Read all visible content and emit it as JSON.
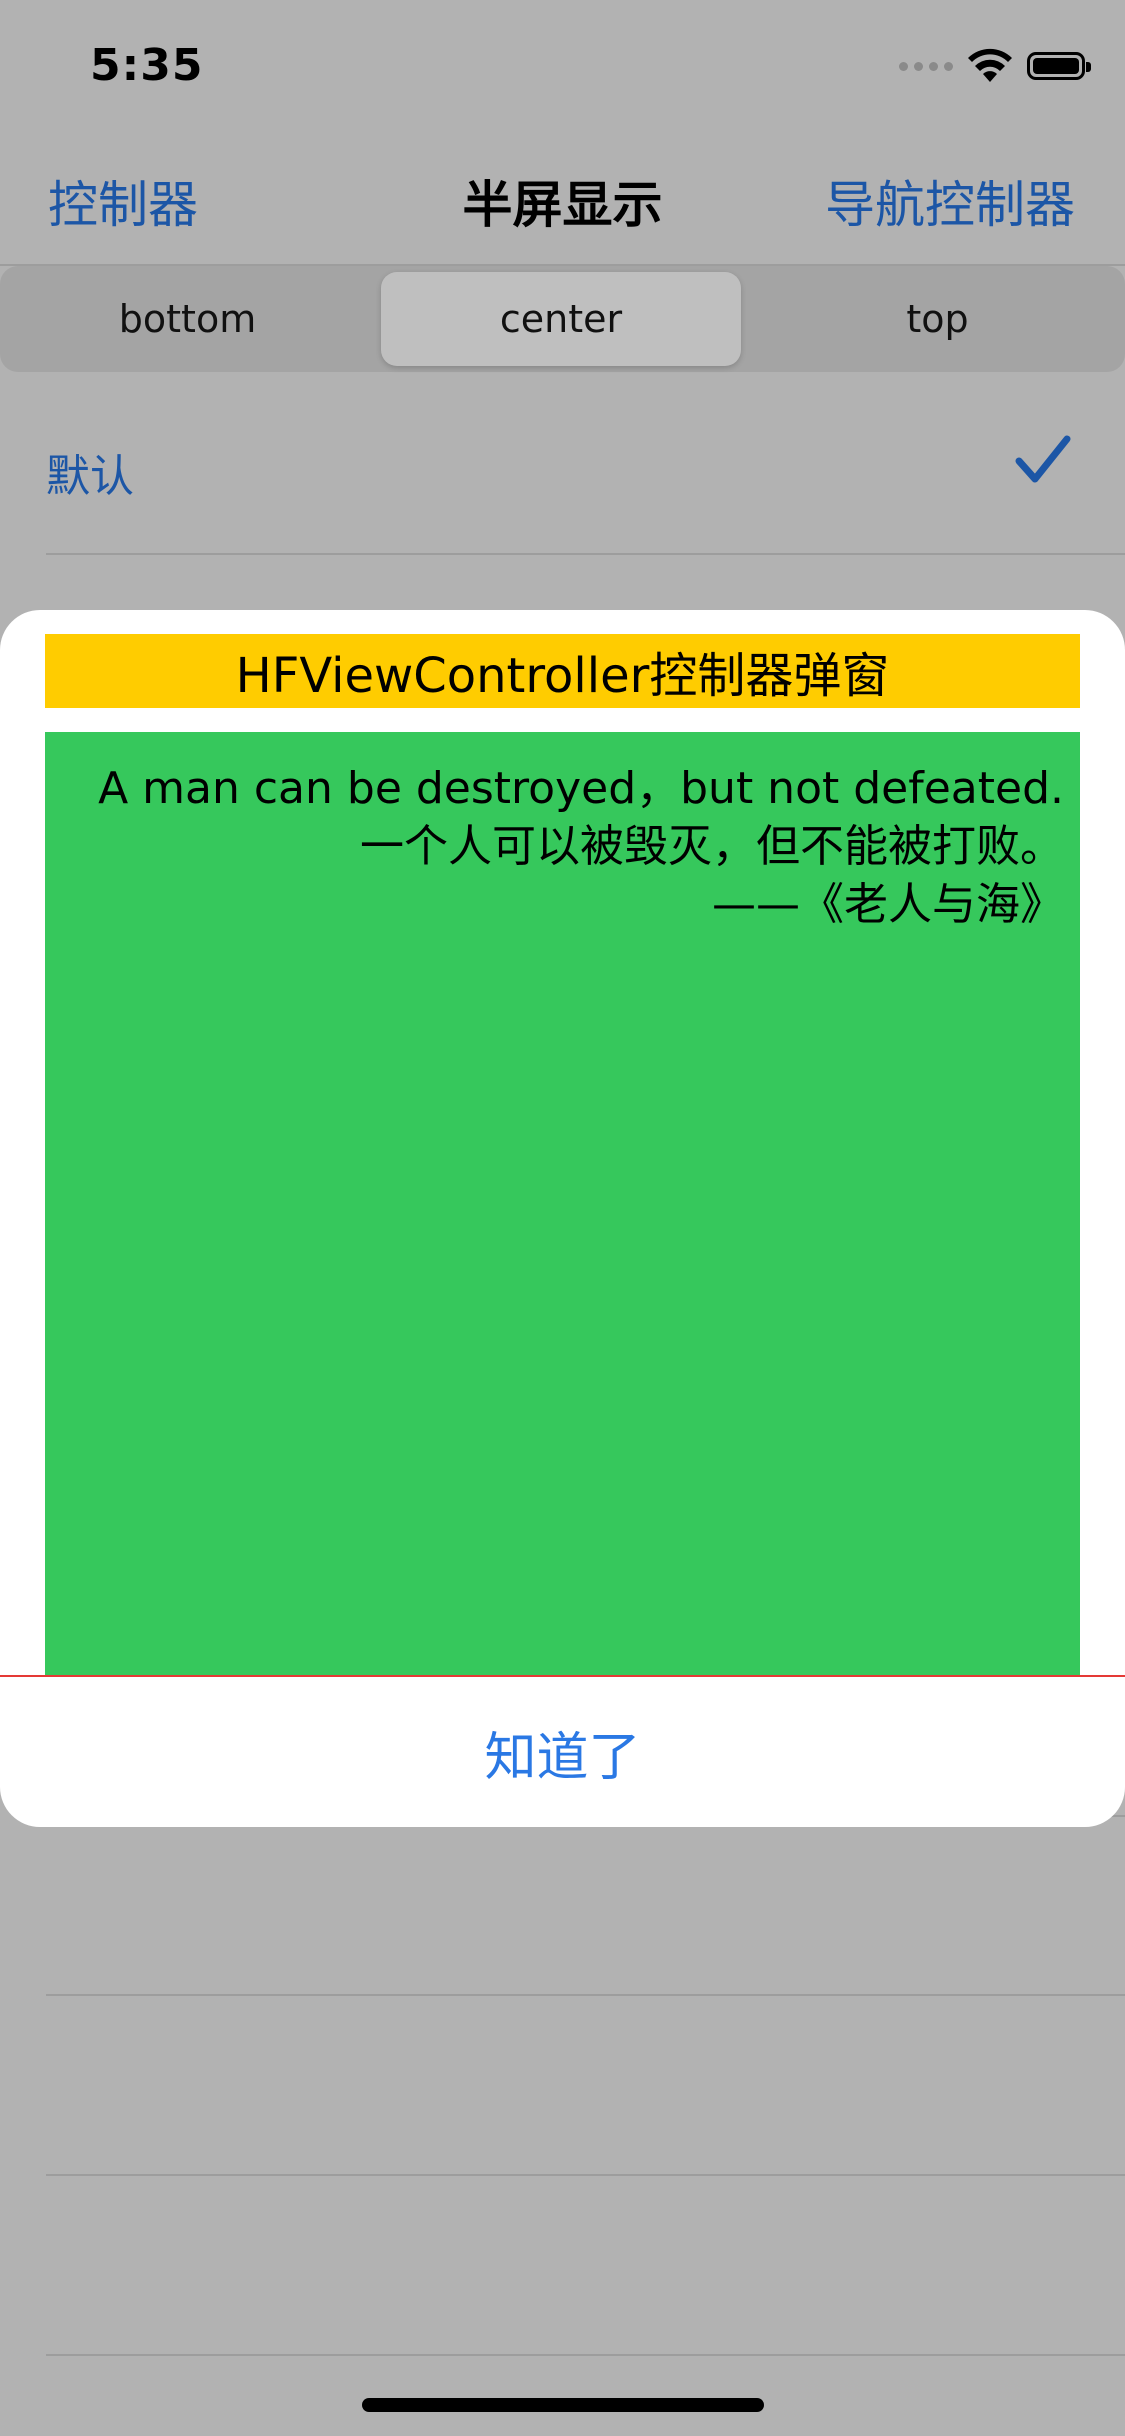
{
  "status_bar": {
    "time": "5:35"
  },
  "nav": {
    "left_label": "控制器",
    "title": "半屏显示",
    "right_label": "导航控制器"
  },
  "segments": [
    "bottom",
    "center",
    "top"
  ],
  "selected_segment": "center",
  "list": {
    "first_row": {
      "label": "默认",
      "checked": true
    }
  },
  "modal": {
    "title": "HFViewController控制器弹窗",
    "quote_lines": [
      "A man can be destroyed，but not defeated.",
      "一个人可以被毁灭，但不能被打败。",
      "——《老人与海》"
    ],
    "button_label": "知道了"
  },
  "colors": {
    "accent": "#1c56a6",
    "button_blue": "#2a78e4",
    "title_bg": "#ffcc00",
    "body_bg": "#36c85c",
    "overlay": "#b2b2b2"
  }
}
